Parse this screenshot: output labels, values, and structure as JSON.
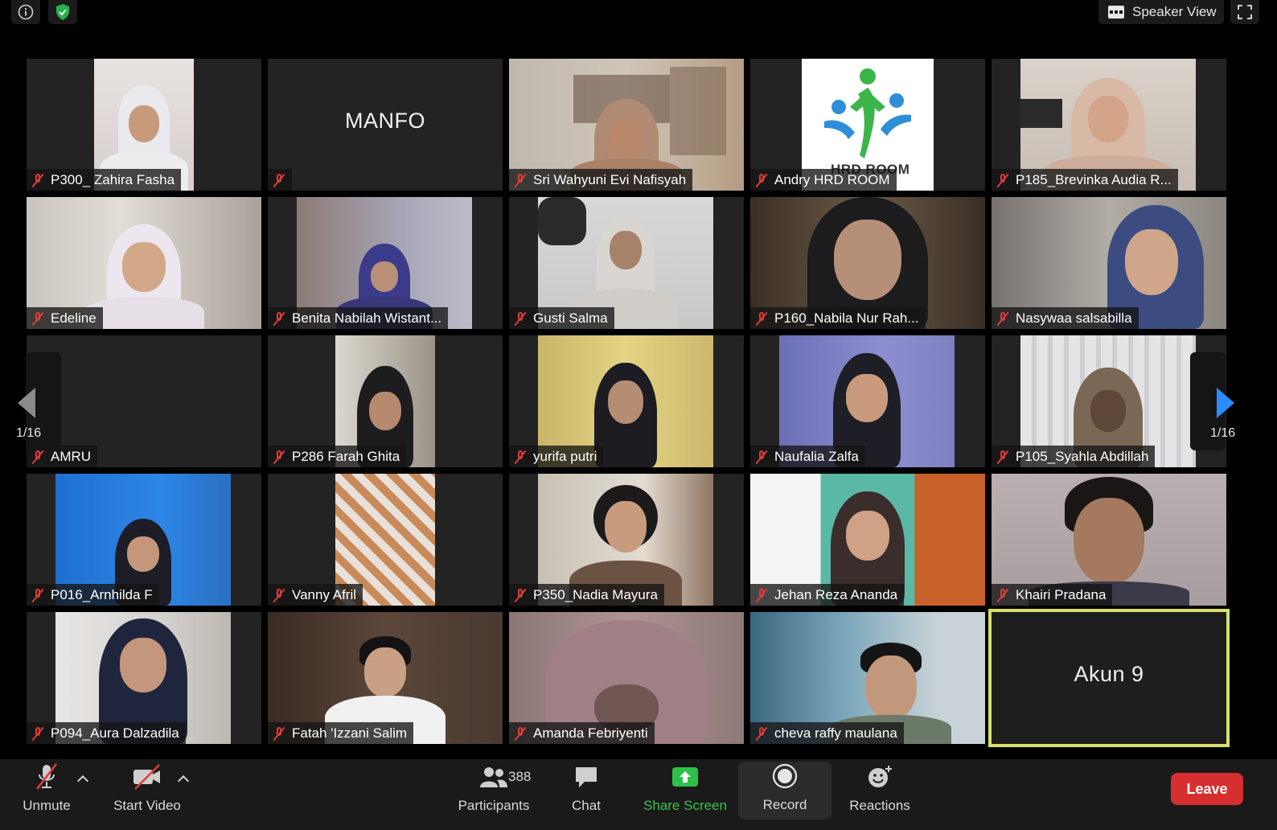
{
  "top_bar": {
    "speaker_view_label": "Speaker View"
  },
  "participants": [
    {
      "name": "P300_ Zahira Fasha"
    },
    {
      "name": "",
      "display_name": "MANFO"
    },
    {
      "name": "Sri Wahyuni Evi Nafisyah"
    },
    {
      "name": "Andry HRD ROOM"
    },
    {
      "name": "P185_Brevinka Audia R..."
    },
    {
      "name": "Edeline"
    },
    {
      "name": "Benita Nabilah Wistant..."
    },
    {
      "name": "Gusti Salma"
    },
    {
      "name": "P160_Nabila Nur Rah..."
    },
    {
      "name": "Nasywaa salsabilla"
    },
    {
      "name": "AMRU"
    },
    {
      "name": "P286 Farah Ghita"
    },
    {
      "name": "yurifa putri"
    },
    {
      "name": "Naufalia Zalfa"
    },
    {
      "name": "P105_Syahla Abdillah"
    },
    {
      "name": "P016_Arnhilda F"
    },
    {
      "name": "Vanny Afril"
    },
    {
      "name": "P350_Nadia Mayura"
    },
    {
      "name": "Jehan Reza Ananda"
    },
    {
      "name": "Khairi Pradana"
    },
    {
      "name": "P094_Aura Dalzadila"
    },
    {
      "name": "Fatah 'Izzani Salim"
    },
    {
      "name": "Amanda Febriyenti"
    },
    {
      "name": "cheva raffy maulana"
    },
    {
      "name": "",
      "display_name": "Akun 9"
    }
  ],
  "pagination": {
    "left": "1/16",
    "right": "1/16"
  },
  "logo_text": "HRD ROOM",
  "toolbar": {
    "unmute": "Unmute",
    "start_video": "Start Video",
    "participants_count": "388",
    "participants": "Participants",
    "chat": "Chat",
    "share_screen": "Share Screen",
    "record": "Record",
    "reactions": "Reactions",
    "leave": "Leave"
  },
  "colors": {
    "accent_blue": "#2d8cff",
    "share_green": "#39c24a",
    "leave_red": "#d72f2f",
    "mute_red": "#e23b3b",
    "speaker_highlight": "#d7df6a"
  }
}
